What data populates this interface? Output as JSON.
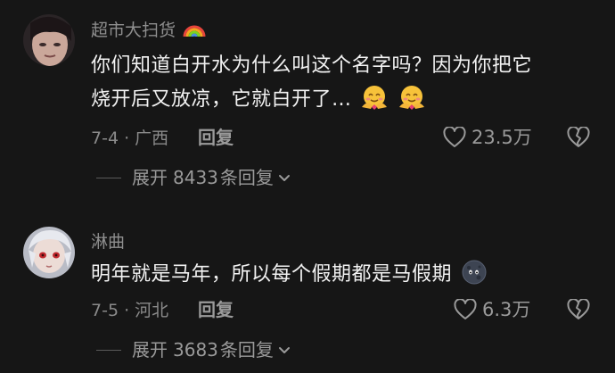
{
  "comments": [
    {
      "username": "超市大扫货",
      "username_emoji": "rainbow-icon",
      "text_line1": "你们知道白开水为什么叫这个名字吗？因为你把它",
      "text_line2": "烧开后又放凉，它就白开了…",
      "trailing_emoji": "smiling-face-with-hearts-hug-icon",
      "date_location": "7-4 · 广西",
      "reply_label": "回复",
      "likes": "23.5万",
      "expand_label": "展开",
      "expand_count": "8433",
      "expand_suffix": "条回复"
    },
    {
      "username": "淋曲",
      "text_line1": "明年就是马年，所以每个假期都是马假期",
      "trailing_emoji": "new-moon-face-icon",
      "date_location": "7-5 · 河北",
      "reply_label": "回复",
      "likes": "6.3万",
      "expand_label": "展开",
      "expand_count": "3683",
      "expand_suffix": "条回复"
    }
  ],
  "colors": {
    "background": "#161616",
    "text_primary": "#f2f2f2",
    "text_secondary": "#8a8a8a"
  }
}
